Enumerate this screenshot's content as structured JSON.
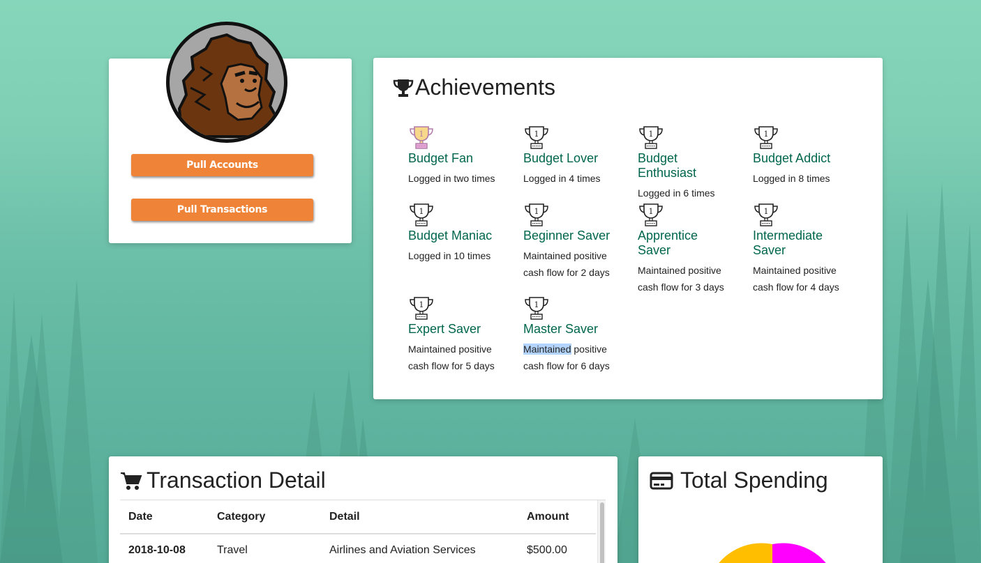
{
  "profile": {
    "pull_accounts_label": "Pull Accounts",
    "pull_transactions_label": "Pull Transactions"
  },
  "achievements": {
    "title": "Achievements",
    "items": [
      {
        "name": "Budget Fan",
        "desc": "Logged in two times",
        "earned": true
      },
      {
        "name": "Budget Lover",
        "desc": "Logged in 4 times",
        "earned": false
      },
      {
        "name": "Budget Enthusiast",
        "desc": "Logged in 6 times",
        "earned": false
      },
      {
        "name": "Budget Addict",
        "desc": "Logged in 8 times",
        "earned": false
      },
      {
        "name": "Budget Maniac",
        "desc": "Logged in 10 times",
        "earned": false
      },
      {
        "name": "Beginner Saver",
        "desc": "Maintained positive cash flow for 2 days",
        "earned": false
      },
      {
        "name": "Apprentice Saver",
        "desc": "Maintained positive cash flow for 3 days",
        "earned": false
      },
      {
        "name": "Intermediate Saver",
        "desc": "Maintained positive cash flow for 4 days",
        "earned": false
      },
      {
        "name": "Expert Saver",
        "desc": "Maintained positive cash flow for 5 days",
        "earned": false
      },
      {
        "name": "Master Saver",
        "desc_highlight": "Maintained",
        "desc_rest": " positive cash flow for 6 days",
        "earned": false
      }
    ],
    "trophy_digit": "1"
  },
  "transactions": {
    "title": "Transaction Detail",
    "columns": [
      "Date",
      "Category",
      "Detail",
      "Amount"
    ],
    "rows": [
      [
        "2018-10-08",
        "Travel",
        "Airlines and Aviation Services",
        "$500.00"
      ]
    ]
  },
  "spending": {
    "title": "Total Spending"
  },
  "colors": {
    "accent_button": "#ef8438",
    "achievement_name": "#00664d",
    "pie_slice_1": "#ffbf00",
    "pie_slice_2": "#ff00ff"
  },
  "icons": {
    "achievements": "trophy-icon",
    "transactions": "shopping-cart-icon",
    "spending": "credit-card-icon",
    "avatar": "bigfoot-avatar"
  }
}
